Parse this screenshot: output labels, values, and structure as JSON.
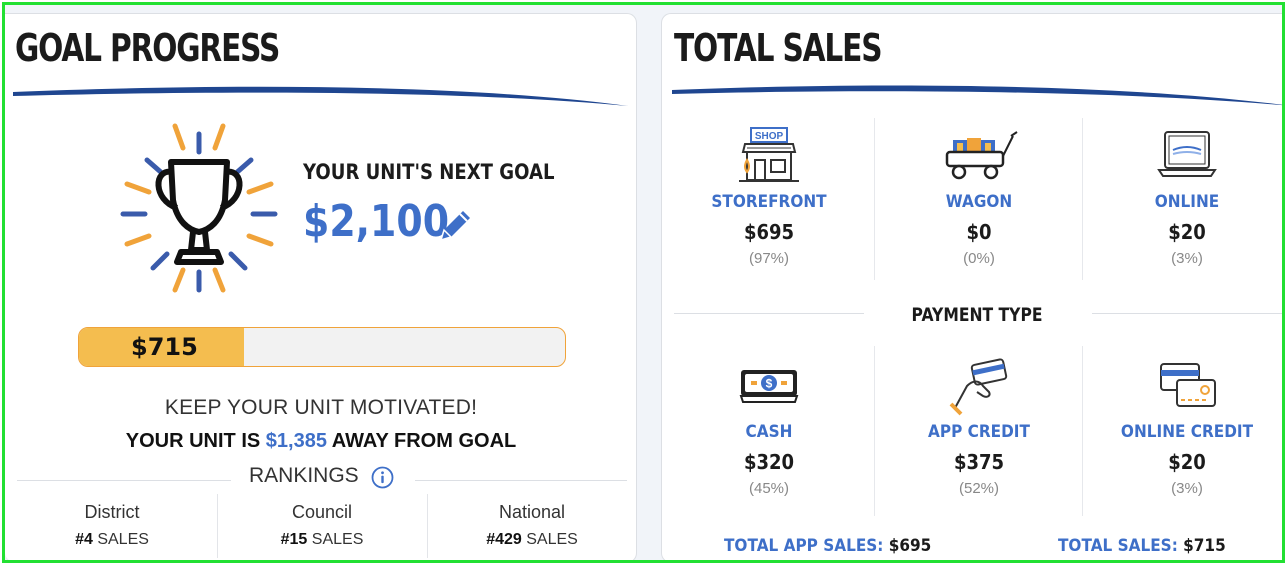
{
  "goal_progress": {
    "title": "GOAL PROGRESS",
    "next_goal_label": "YOUR UNIT'S NEXT GOAL",
    "next_goal_amount": "$2,100",
    "progress": {
      "label": "$715",
      "fraction": 0.34
    },
    "motivation": "KEEP YOUR UNIT MOTIVATED!",
    "away_prefix": "YOUR UNIT IS ",
    "away_amount": "$1,385",
    "away_suffix": " AWAY FROM GOAL",
    "rankings_title": "RANKINGS",
    "rankings": [
      {
        "name": "District",
        "rank": "#4",
        "unit": " SALES"
      },
      {
        "name": "Council",
        "rank": "#15",
        "unit": " SALES"
      },
      {
        "name": "National",
        "rank": "#429",
        "unit": " SALES"
      }
    ]
  },
  "total_sales": {
    "title": "TOTAL SALES",
    "channels": [
      {
        "name": "STOREFRONT",
        "amount": "$695",
        "percent": "(97%)",
        "icon": "shop-icon"
      },
      {
        "name": "WAGON",
        "amount": "$0",
        "percent": "(0%)",
        "icon": "wagon-icon"
      },
      {
        "name": "ONLINE",
        "amount": "$20",
        "percent": "(3%)",
        "icon": "laptop-icon"
      }
    ],
    "payment_type_title": "PAYMENT TYPE",
    "payments": [
      {
        "name": "CASH",
        "amount": "$320",
        "percent": "(45%)",
        "icon": "cash-icon"
      },
      {
        "name": "APP CREDIT",
        "amount": "$375",
        "percent": "(52%)",
        "icon": "card-hand-icon"
      },
      {
        "name": "ONLINE CREDIT",
        "amount": "$20",
        "percent": "(3%)",
        "icon": "credit-cards-icon"
      }
    ],
    "total_app_sales_label": "TOTAL APP SALES: ",
    "total_app_sales_value": "$695",
    "total_sales_label": "TOTAL SALES: ",
    "total_sales_value": "$715"
  },
  "colors": {
    "accent_blue": "#3e6fc8",
    "progress_fill": "#f4bd4f",
    "progress_border": "#f0a33a",
    "frame_green": "#22e032"
  }
}
